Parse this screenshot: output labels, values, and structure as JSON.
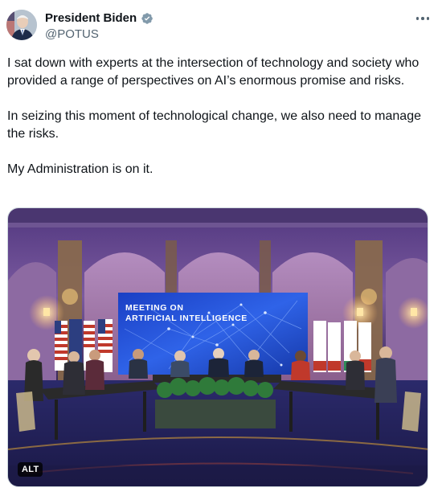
{
  "author": {
    "display_name": "President Biden",
    "handle": "@POTUS",
    "avatar_icon": "avatar-photo",
    "verified_icon": "verified-badge-icon",
    "verified_color": "#829aab"
  },
  "tweet": {
    "paragraphs": [
      "I sat down with experts at the intersection of technology and society who provided a range of perspectives on AI’s enormous promise and risks.",
      "In seizing this moment of technological change, we also need to manage the risks.",
      "My Administration is on it."
    ]
  },
  "media": {
    "screen_line1": "MEETING ON",
    "screen_line2": "ARTIFICIAL INTELLIGENCE",
    "alt_label": "ALT"
  },
  "menu": {
    "more_icon": "more-horizontal-icon"
  },
  "colors": {
    "text_primary": "#0f1419",
    "text_secondary": "#536471",
    "screen_blue": "#1f4fd8"
  }
}
